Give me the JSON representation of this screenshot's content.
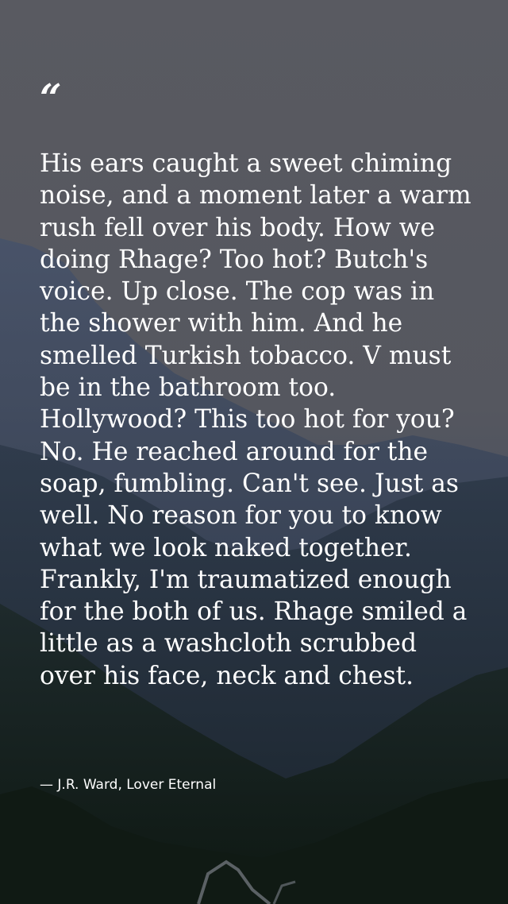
{
  "quote": {
    "mark": "“",
    "text": "His ears caught a sweet chiming noise, and a moment later a warm rush fell over his body. How we doing Rhage? Too hot? Butch's voice. Up close. The cop was in the shower with him. And he smelled Turkish tobacco. V must be in the bathroom too. Hollywood? This too hot for you? No. He reached around for the soap, fumbling. Can't see. Just as well. No reason for you to know what we look naked together. Frankly, I'm traumatized enough for the both of us. Rhage smiled a little as a washcloth scrubbed over his face, neck and chest.",
    "attribution": "— J.R. Ward, Lover Eternal"
  },
  "colors": {
    "sky": "#56585f",
    "text": "#ffffff",
    "mountain_far": "#3a4458",
    "mountain_near": "#1f2a34",
    "forest": "#14201a"
  }
}
